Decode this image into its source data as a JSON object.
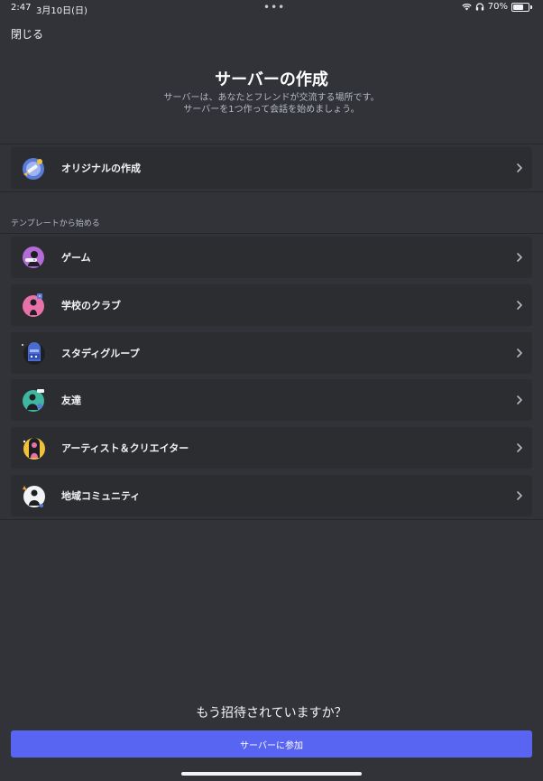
{
  "status_bar": {
    "time": "2:47",
    "date": "3月10日(日)",
    "dots": "•••",
    "battery": "70%",
    "battery_level": 0.7
  },
  "header": {
    "close_label": "閉じる",
    "title": "サーバーの作成",
    "subtitle_line1": "サーバーは、あなたとフレンドが交流する場所です。",
    "subtitle_line2": "サーバーを1つ作って会話を始めましょう。"
  },
  "create_own": {
    "label": "オリジナルの作成",
    "icon": "original-server-icon"
  },
  "templates": {
    "section_label": "テンプレートから始める",
    "items": [
      {
        "label": "ゲーム",
        "icon": "gaming-icon",
        "color": "#b36bd8"
      },
      {
        "label": "学校のクラブ",
        "icon": "school-club-icon",
        "color": "#e871a9"
      },
      {
        "label": "スタディグループ",
        "icon": "study-group-icon",
        "color": "#4a6bd1"
      },
      {
        "label": "友達",
        "icon": "friends-icon",
        "color": "#3fb7a0"
      },
      {
        "label": "アーティスト＆クリエイター",
        "icon": "artists-creators-icon",
        "color": "#f0c13a"
      },
      {
        "label": "地域コミュニティ",
        "icon": "local-community-icon",
        "color": "#f2f3f5"
      }
    ]
  },
  "footer": {
    "question": "もう招待されていますか？",
    "join_label": "サーバーに参加"
  },
  "colors": {
    "background": "#313338",
    "row_background": "#2b2d31",
    "accent": "#5865f2"
  }
}
